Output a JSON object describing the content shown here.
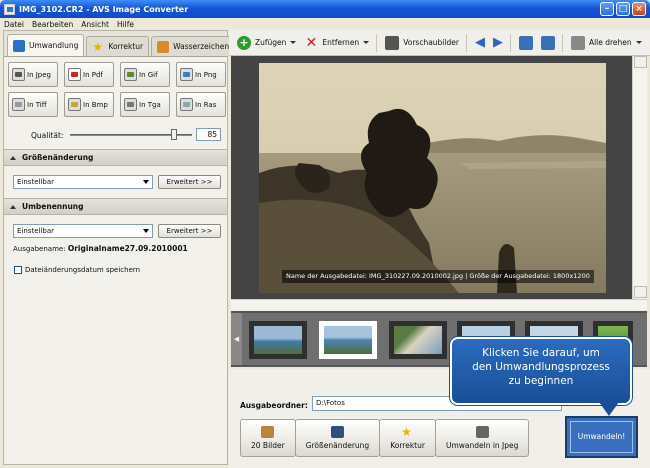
{
  "window": {
    "title": "IMG_3102.CR2 - AVS Image Converter",
    "min": "–",
    "max": "□",
    "close": "×"
  },
  "menu": [
    "Datei",
    "Bearbeiten",
    "Ansicht",
    "Hilfe"
  ],
  "tabs": [
    "Umwandlung",
    "Korrektur",
    "Wasserzeichen"
  ],
  "formats": [
    {
      "label": "In Jpeg",
      "icon": "jpeg-camera-icon"
    },
    {
      "label": "In Pdf",
      "icon": "pdf-icon"
    },
    {
      "label": "In Gif",
      "icon": "gif-icon"
    },
    {
      "label": "In Png",
      "icon": "png-icon"
    },
    {
      "label": "In Tiff",
      "icon": "tiff-icon"
    },
    {
      "label": "In Bmp",
      "icon": "bmp-icon"
    },
    {
      "label": "In Tga",
      "icon": "tga-icon"
    },
    {
      "label": "In Ras",
      "icon": "ras-icon"
    }
  ],
  "quality": {
    "label": "Qualität:",
    "value": "85",
    "level_percent": 85
  },
  "resize": {
    "header": "Größenänderung",
    "select_value": "Einstellbar",
    "advanced": "Erweitert >>"
  },
  "rename": {
    "header": "Umbenennung",
    "select_value": "Einstellbar",
    "advanced": "Erweitert >>",
    "outname_label": "Ausgabename:",
    "outname_value": "Originalname27.09.2010001"
  },
  "keep_date": "Dateiänderungsdatum speichern",
  "toolbar": {
    "add": "Zufügen",
    "remove": "Entfernen",
    "preview": "Vorschaubilder",
    "rotate_all": "Alle drehen"
  },
  "preview": {
    "info": "Name der Ausgabedatei: IMG_310227.09.2010002.jpg | Größe der Ausgabedatei: 1800x1200"
  },
  "output": {
    "label": "Ausgabeordner:",
    "folder": "D:\\Fotos"
  },
  "steps": [
    {
      "label": "20 Bilder",
      "icon": "images-icon"
    },
    {
      "label": "Größenänderung",
      "icon": "resize-icon"
    },
    {
      "label": "Korrektur",
      "icon": "star-icon"
    },
    {
      "label": "Umwandeln in Jpeg",
      "icon": "camera-icon"
    }
  ],
  "convert_button": "Umwandeln!",
  "callout": {
    "line1": "Klicken Sie darauf, um",
    "line2": "den Umwandlungsprozess",
    "line3": "zu beginnen"
  },
  "colors": {
    "titlebar": "#1556d8",
    "accent": "#3a6ebf",
    "callout": "#1a4f98"
  }
}
